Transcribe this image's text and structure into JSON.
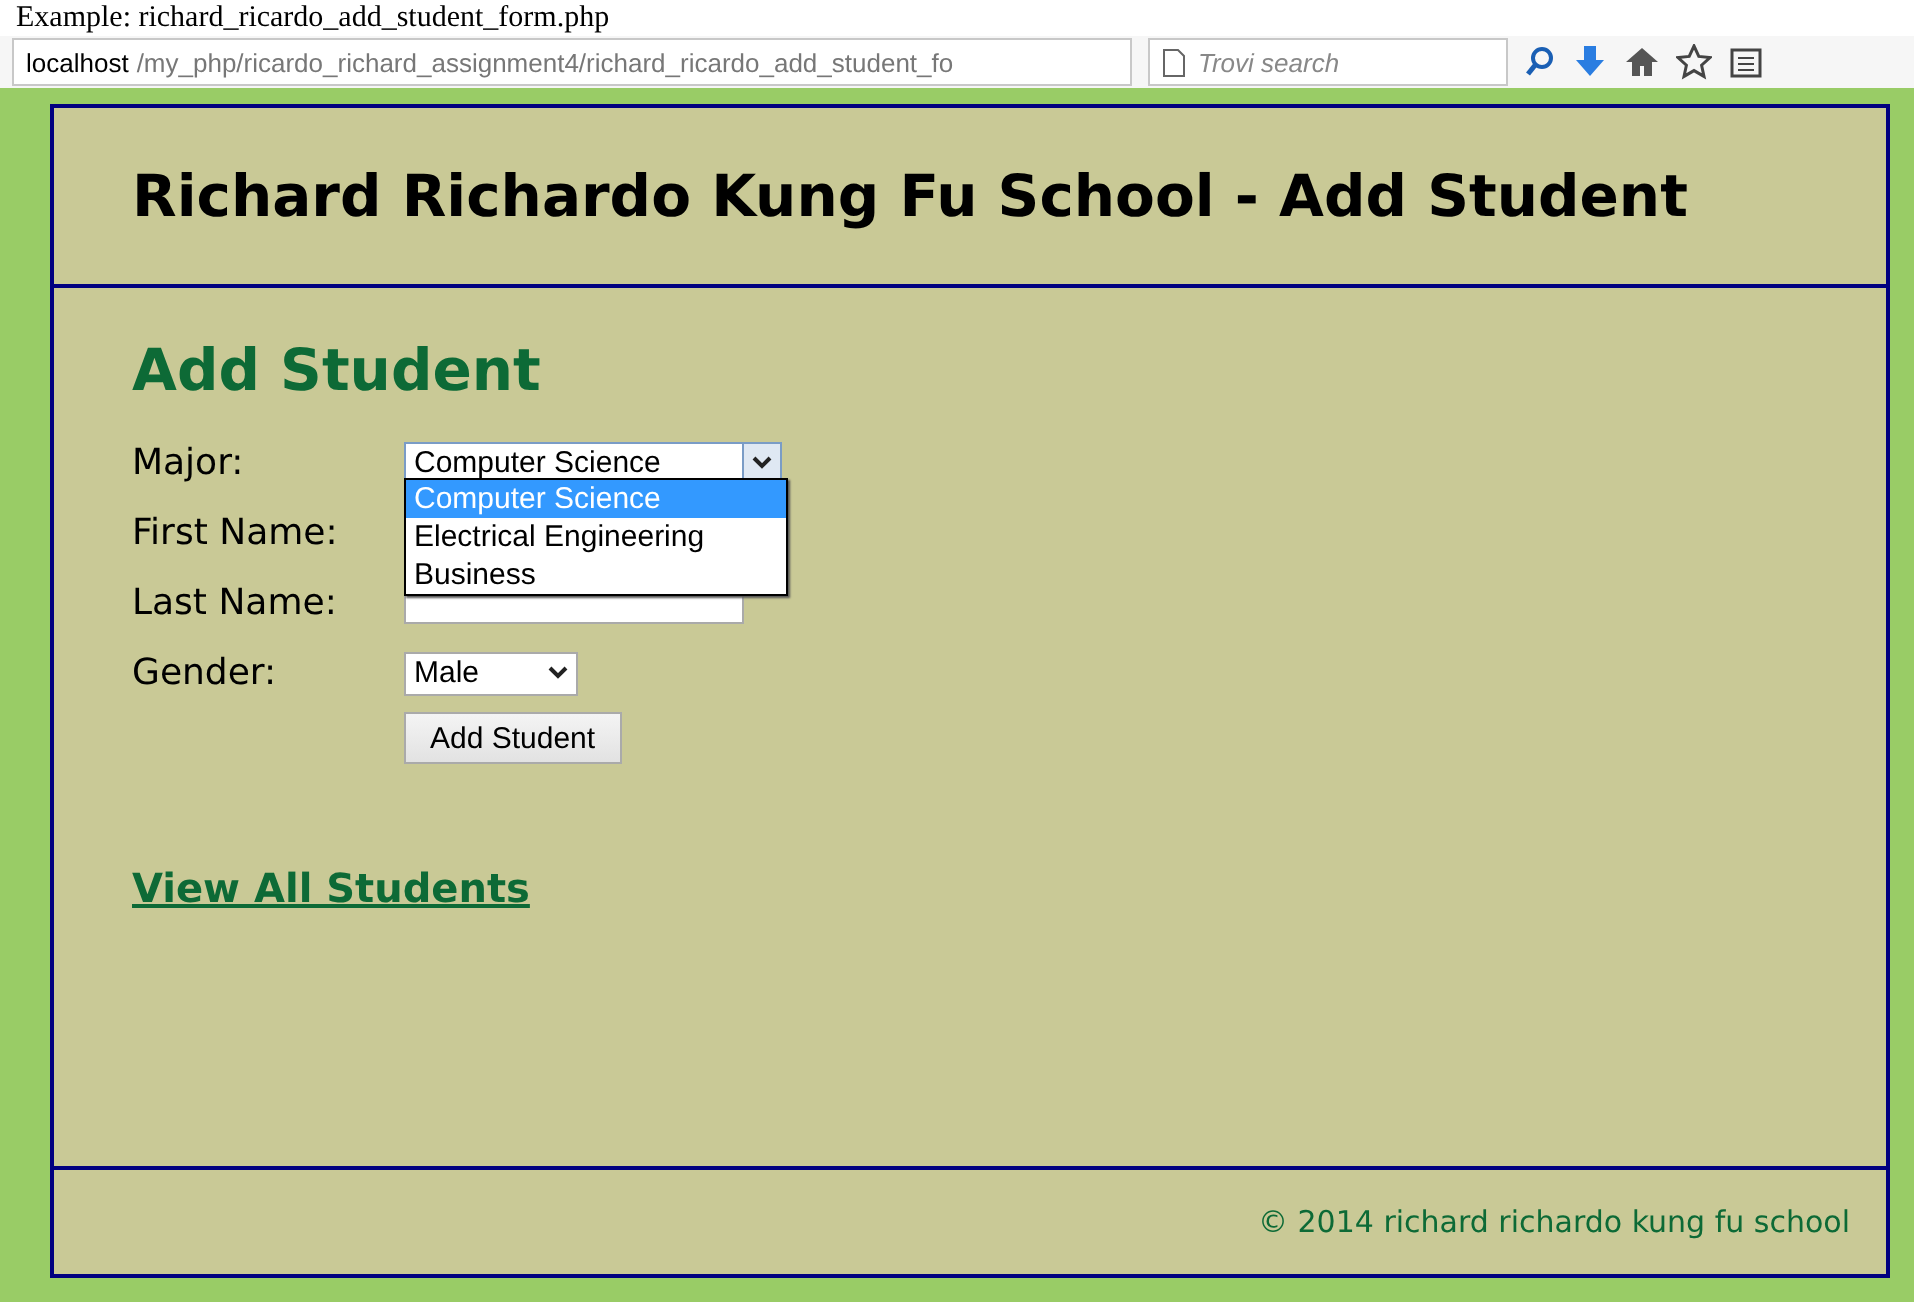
{
  "caption": "Example: richard_ricardo_add_student_form.php",
  "browser": {
    "url_host": "localhost",
    "url_path": "/my_php/ricardo_richard_assignment4/richard_ricardo_add_student_fo",
    "search_placeholder": "Trovi search"
  },
  "header": {
    "title": "Richard Richardo Kung Fu School - Add Student"
  },
  "form": {
    "heading": "Add Student",
    "major": {
      "label": "Major:",
      "value": "Computer Science",
      "expanded": true,
      "options": [
        {
          "label": "Computer Science",
          "selected": true
        },
        {
          "label": "Electrical Engineering",
          "selected": false
        },
        {
          "label": "Business",
          "selected": false
        }
      ]
    },
    "first_name": {
      "label": "First Name:"
    },
    "last_name": {
      "label": "Last Name:"
    },
    "gender": {
      "label": "Gender:",
      "value": "Male"
    },
    "submit": "Add Student"
  },
  "link": "View All Students",
  "footer": "© 2014 richard richardo kung fu school"
}
